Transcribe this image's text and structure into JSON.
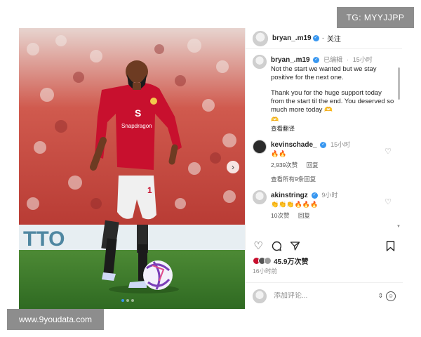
{
  "watermarks": {
    "top": "TG: MYYJJPP",
    "bottom": "www.9youdata.com"
  },
  "post": {
    "username": "bryan_.m19",
    "follow_label": "关注",
    "image_dots": 3,
    "active_dot": 0
  },
  "caption": {
    "username": "bryan_.m19",
    "edited": "已编辑",
    "age": "15小时",
    "paragraph1": "Not the start we wanted but we stay positive for the next one.",
    "paragraph2": "Thank you for the huge support today from the start til the end. You deserved so much more today 🫶",
    "trailing_emoji": "🫶",
    "see_translation": "查看翻译"
  },
  "comments": [
    {
      "username": "kevinschade_",
      "age": "15小时",
      "text": "🔥🔥",
      "likes": "2,939次赞",
      "reply": "回复",
      "view_all": "查看所有9条回复"
    },
    {
      "username": "akinstringz",
      "age": "9小时",
      "text": "👏👏👏🔥🔥🔥",
      "likes": "10次赞",
      "reply": "回复"
    }
  ],
  "likes_count": "45.9万次赞",
  "post_age": "16小时前",
  "comment_box": {
    "placeholder": "添加评论..."
  },
  "colors": {
    "accent": "#3897f0",
    "jersey": "#c8102e",
    "pitch": "#3f7a2b"
  }
}
